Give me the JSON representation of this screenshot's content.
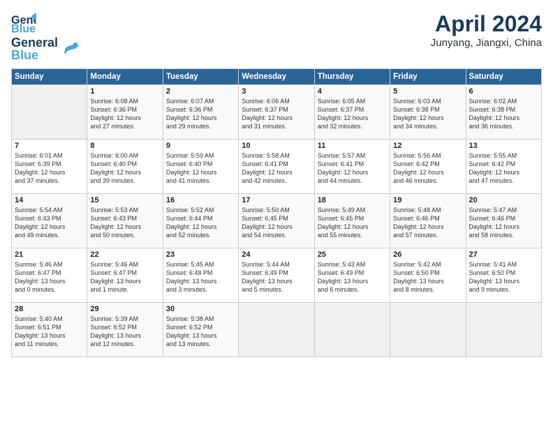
{
  "header": {
    "logo_line1": "General",
    "logo_line2": "Blue",
    "month": "April 2024",
    "location": "Junyang, Jiangxi, China"
  },
  "weekdays": [
    "Sunday",
    "Monday",
    "Tuesday",
    "Wednesday",
    "Thursday",
    "Friday",
    "Saturday"
  ],
  "weeks": [
    [
      {
        "day": "",
        "info": ""
      },
      {
        "day": "1",
        "info": "Sunrise: 6:08 AM\nSunset: 6:36 PM\nDaylight: 12 hours\nand 27 minutes."
      },
      {
        "day": "2",
        "info": "Sunrise: 6:07 AM\nSunset: 6:36 PM\nDaylight: 12 hours\nand 29 minutes."
      },
      {
        "day": "3",
        "info": "Sunrise: 6:06 AM\nSunset: 6:37 PM\nDaylight: 12 hours\nand 31 minutes."
      },
      {
        "day": "4",
        "info": "Sunrise: 6:05 AM\nSunset: 6:37 PM\nDaylight: 12 hours\nand 32 minutes."
      },
      {
        "day": "5",
        "info": "Sunrise: 6:03 AM\nSunset: 6:38 PM\nDaylight: 12 hours\nand 34 minutes."
      },
      {
        "day": "6",
        "info": "Sunrise: 6:02 AM\nSunset: 6:38 PM\nDaylight: 12 hours\nand 36 minutes."
      }
    ],
    [
      {
        "day": "7",
        "info": "Sunrise: 6:01 AM\nSunset: 6:39 PM\nDaylight: 12 hours\nand 37 minutes."
      },
      {
        "day": "8",
        "info": "Sunrise: 6:00 AM\nSunset: 6:40 PM\nDaylight: 12 hours\nand 39 minutes."
      },
      {
        "day": "9",
        "info": "Sunrise: 5:59 AM\nSunset: 6:40 PM\nDaylight: 12 hours\nand 41 minutes."
      },
      {
        "day": "10",
        "info": "Sunrise: 5:58 AM\nSunset: 6:41 PM\nDaylight: 12 hours\nand 42 minutes."
      },
      {
        "day": "11",
        "info": "Sunrise: 5:57 AM\nSunset: 6:41 PM\nDaylight: 12 hours\nand 44 minutes."
      },
      {
        "day": "12",
        "info": "Sunrise: 5:56 AM\nSunset: 6:42 PM\nDaylight: 12 hours\nand 46 minutes."
      },
      {
        "day": "13",
        "info": "Sunrise: 5:55 AM\nSunset: 6:42 PM\nDaylight: 12 hours\nand 47 minutes."
      }
    ],
    [
      {
        "day": "14",
        "info": "Sunrise: 5:54 AM\nSunset: 6:43 PM\nDaylight: 12 hours\nand 49 minutes."
      },
      {
        "day": "15",
        "info": "Sunrise: 5:53 AM\nSunset: 6:43 PM\nDaylight: 12 hours\nand 50 minutes."
      },
      {
        "day": "16",
        "info": "Sunrise: 5:52 AM\nSunset: 6:44 PM\nDaylight: 12 hours\nand 52 minutes."
      },
      {
        "day": "17",
        "info": "Sunrise: 5:50 AM\nSunset: 6:45 PM\nDaylight: 12 hours\nand 54 minutes."
      },
      {
        "day": "18",
        "info": "Sunrise: 5:49 AM\nSunset: 6:45 PM\nDaylight: 12 hours\nand 55 minutes."
      },
      {
        "day": "19",
        "info": "Sunrise: 5:48 AM\nSunset: 6:46 PM\nDaylight: 12 hours\nand 57 minutes."
      },
      {
        "day": "20",
        "info": "Sunrise: 5:47 AM\nSunset: 6:46 PM\nDaylight: 12 hours\nand 58 minutes."
      }
    ],
    [
      {
        "day": "21",
        "info": "Sunrise: 5:46 AM\nSunset: 6:47 PM\nDaylight: 13 hours\nand 0 minutes."
      },
      {
        "day": "22",
        "info": "Sunrise: 5:46 AM\nSunset: 6:47 PM\nDaylight: 13 hours\nand 1 minute."
      },
      {
        "day": "23",
        "info": "Sunrise: 5:45 AM\nSunset: 6:48 PM\nDaylight: 13 hours\nand 3 minutes."
      },
      {
        "day": "24",
        "info": "Sunrise: 5:44 AM\nSunset: 6:49 PM\nDaylight: 13 hours\nand 5 minutes."
      },
      {
        "day": "25",
        "info": "Sunrise: 5:43 AM\nSunset: 6:49 PM\nDaylight: 13 hours\nand 6 minutes."
      },
      {
        "day": "26",
        "info": "Sunrise: 5:42 AM\nSunset: 6:50 PM\nDaylight: 13 hours\nand 8 minutes."
      },
      {
        "day": "27",
        "info": "Sunrise: 5:41 AM\nSunset: 6:50 PM\nDaylight: 13 hours\nand 9 minutes."
      }
    ],
    [
      {
        "day": "28",
        "info": "Sunrise: 5:40 AM\nSunset: 6:51 PM\nDaylight: 13 hours\nand 11 minutes."
      },
      {
        "day": "29",
        "info": "Sunrise: 5:39 AM\nSunset: 6:52 PM\nDaylight: 13 hours\nand 12 minutes."
      },
      {
        "day": "30",
        "info": "Sunrise: 5:38 AM\nSunset: 6:52 PM\nDaylight: 13 hours\nand 13 minutes."
      },
      {
        "day": "",
        "info": ""
      },
      {
        "day": "",
        "info": ""
      },
      {
        "day": "",
        "info": ""
      },
      {
        "day": "",
        "info": ""
      }
    ]
  ]
}
